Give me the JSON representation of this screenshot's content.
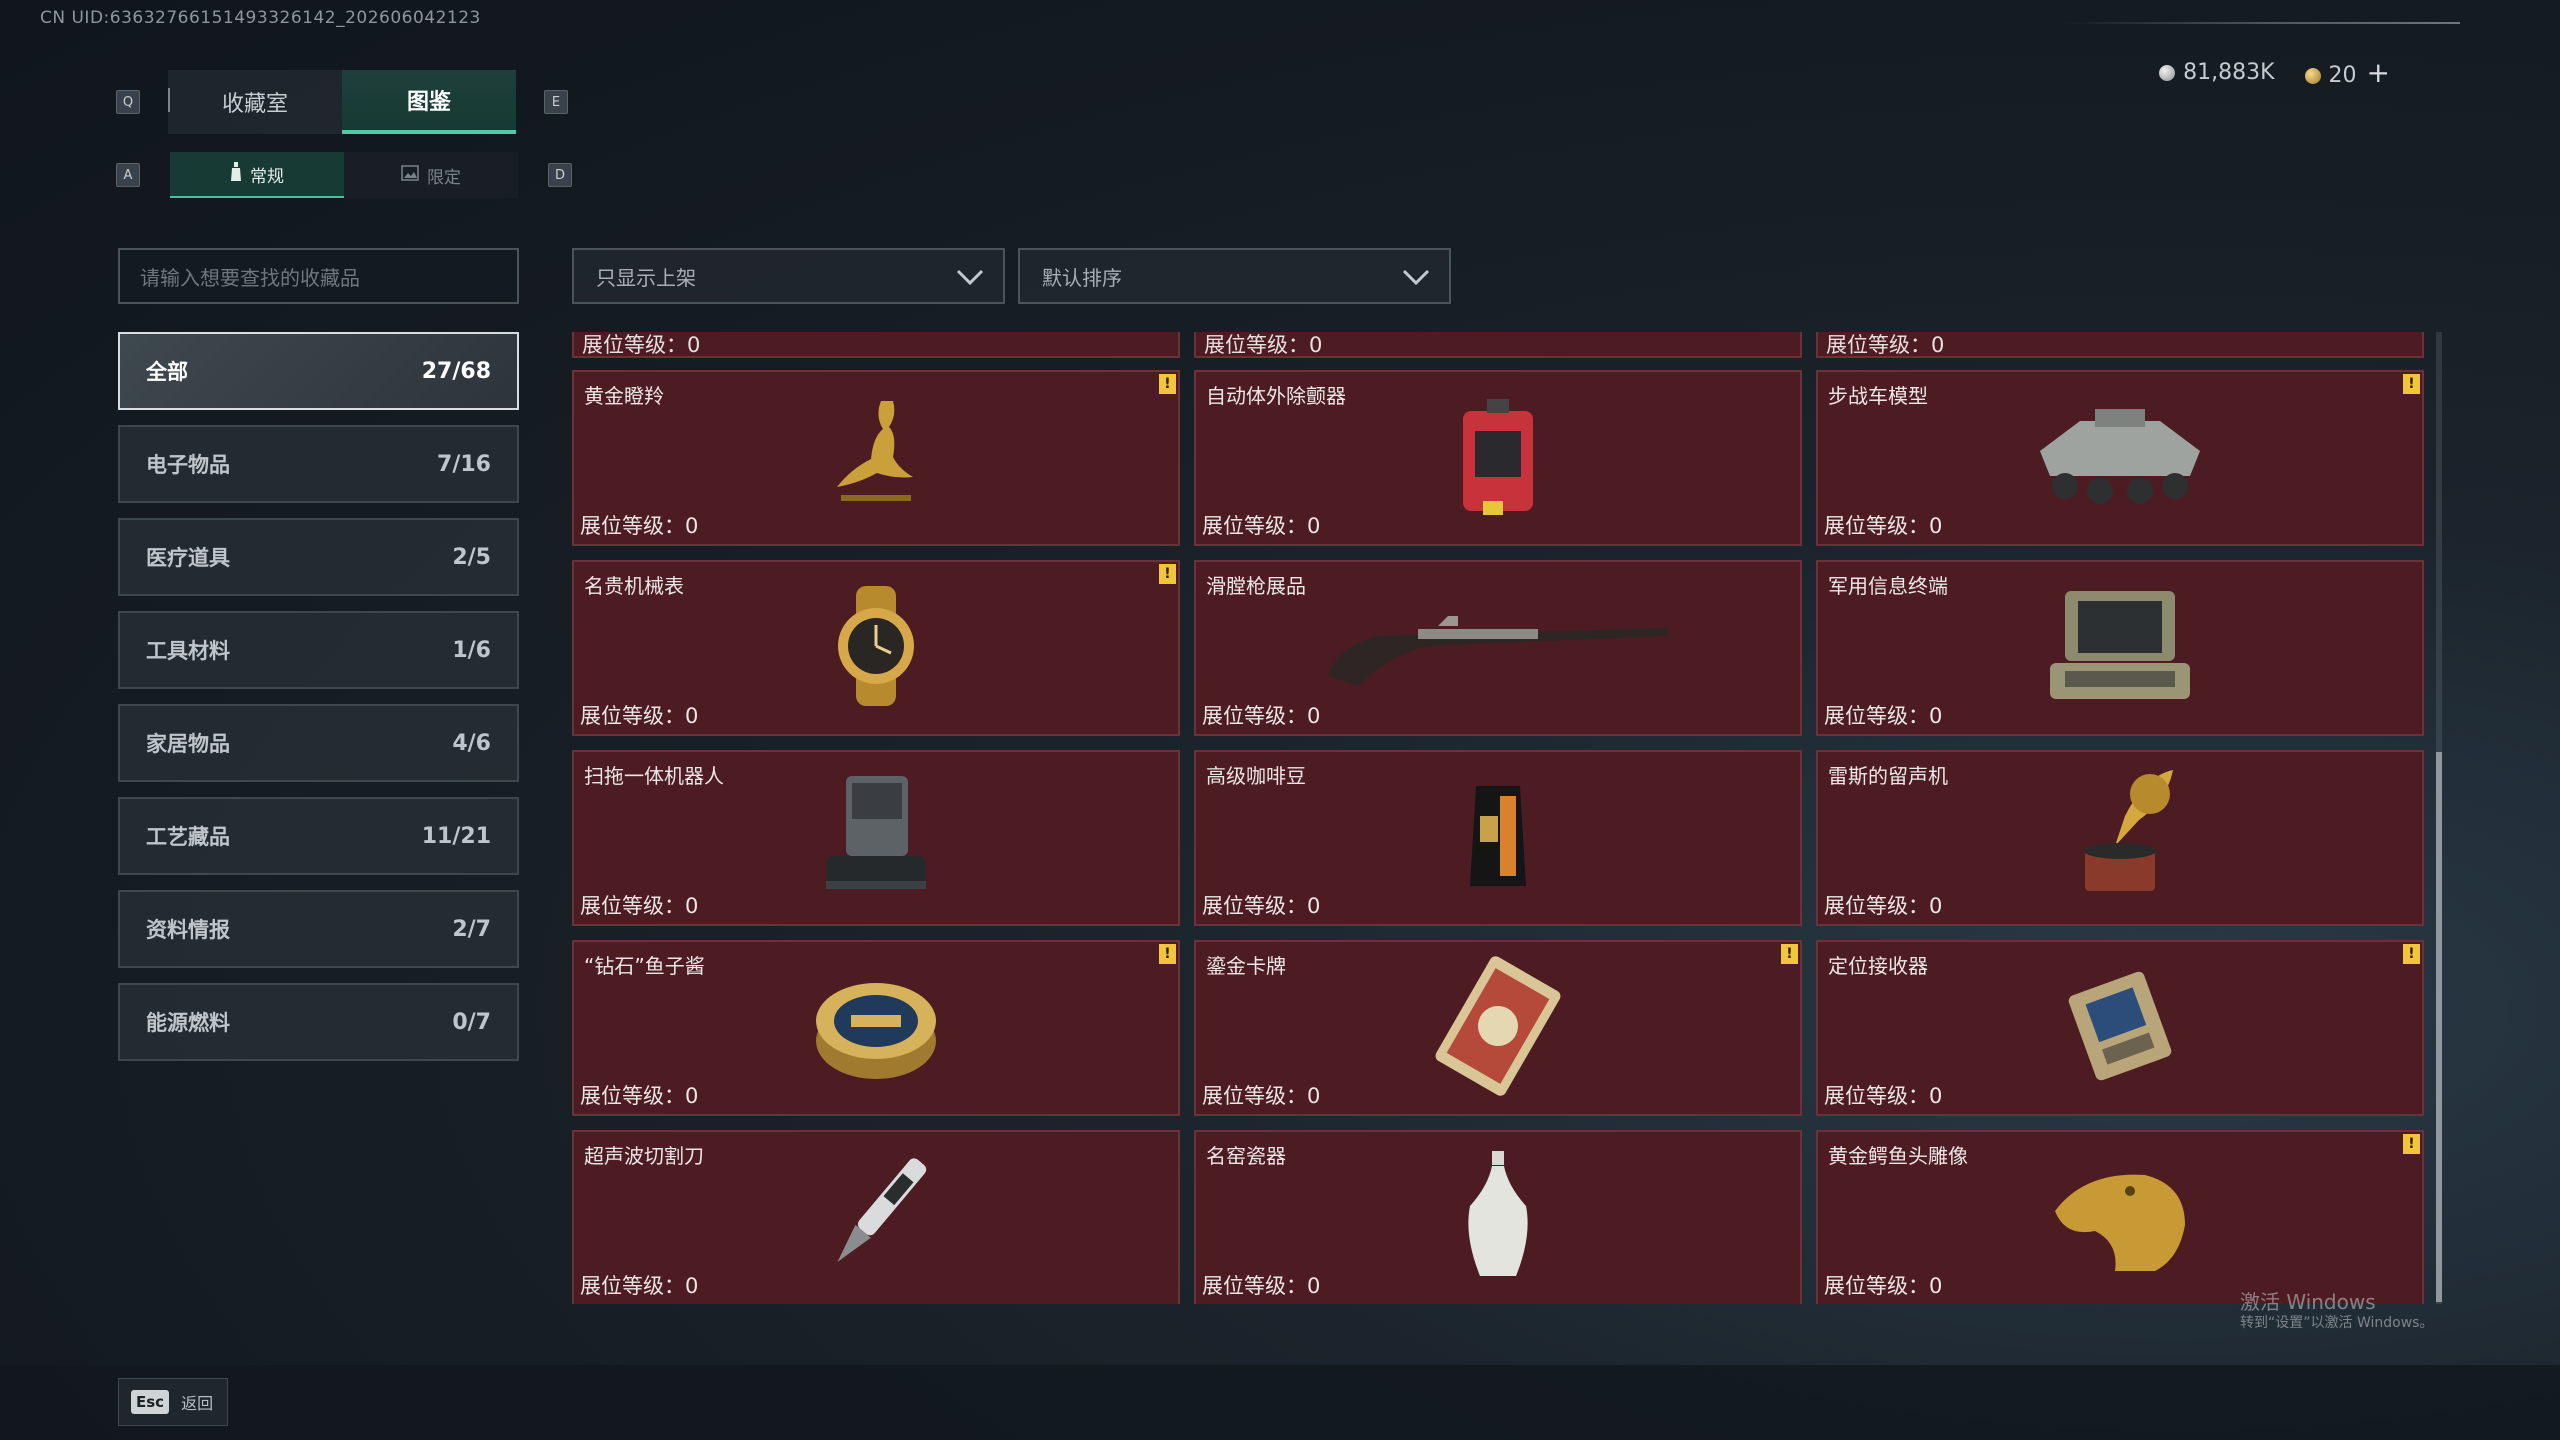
{
  "uid_text": "CN UID:6363276615149332614​2_202606042123",
  "keys": {
    "prev_tab": "Q",
    "next_tab": "E",
    "prev_sub": "A",
    "next_sub": "D"
  },
  "main_tabs": [
    {
      "label": "收藏室"
    },
    {
      "label": "图鉴"
    }
  ],
  "sub_tabs": [
    {
      "label": "常规"
    },
    {
      "label": "限定"
    }
  ],
  "currency": {
    "silver": "81,883K",
    "gold": "20",
    "plus": "+"
  },
  "search": {
    "placeholder": "请输入想要查找的收藏品"
  },
  "filters": {
    "shelf": "只显示上架",
    "sort": "默认排序"
  },
  "categories": [
    {
      "label": "全部",
      "count": "27/68"
    },
    {
      "label": "电子物品",
      "count": "7/16"
    },
    {
      "label": "医疗道具",
      "count": "2/5"
    },
    {
      "label": "工具材料",
      "count": "1/6"
    },
    {
      "label": "家居物品",
      "count": "4/6"
    },
    {
      "label": "工艺藏品",
      "count": "11/21"
    },
    {
      "label": "资料情报",
      "count": "2/7"
    },
    {
      "label": "能源燃料",
      "count": "0/7"
    }
  ],
  "level_label": "展位等级：0",
  "items": [
    {
      "name": "黄金瞪羚",
      "warn": true,
      "icon": "gazelle-statue-icon"
    },
    {
      "name": "自动体外除颤器",
      "warn": false,
      "icon": "defibrillator-icon"
    },
    {
      "name": "步战车模型",
      "warn": true,
      "icon": "apc-model-icon"
    },
    {
      "name": "名贵机械表",
      "warn": true,
      "icon": "watch-icon"
    },
    {
      "name": "滑膛枪展品",
      "warn": false,
      "icon": "musket-icon"
    },
    {
      "name": "军用信息终端",
      "warn": false,
      "icon": "military-terminal-icon"
    },
    {
      "name": "扫拖一体机器人",
      "warn": false,
      "icon": "robot-vacuum-icon"
    },
    {
      "name": "高级咖啡豆",
      "warn": false,
      "icon": "coffee-bag-icon"
    },
    {
      "name": "雷斯的留声机",
      "warn": false,
      "icon": "gramophone-icon"
    },
    {
      "name": "“钻石”鱼子酱",
      "warn": true,
      "icon": "caviar-tin-icon"
    },
    {
      "name": "鎏金卡牌",
      "warn": true,
      "icon": "gilded-card-icon"
    },
    {
      "name": "定位接收器",
      "warn": true,
      "icon": "locator-receiver-icon"
    },
    {
      "name": "超声波切割刀",
      "warn": false,
      "icon": "ultrasonic-cutter-icon"
    },
    {
      "name": "名窑瓷器",
      "warn": false,
      "icon": "porcelain-vase-icon"
    },
    {
      "name": "黄金鳄鱼头雕像",
      "warn": true,
      "icon": "crocodile-head-icon"
    }
  ],
  "warn_glyph": "!",
  "watermark": {
    "line1": "激活 Windows",
    "line2": "转到“设置”以激活 Windows。"
  },
  "footer": {
    "esc_key": "Esc",
    "back_label": "返回"
  },
  "colors": {
    "accent": "#52c9a4",
    "card_bg": "#4d1c22",
    "warn": "#f2c53a"
  }
}
